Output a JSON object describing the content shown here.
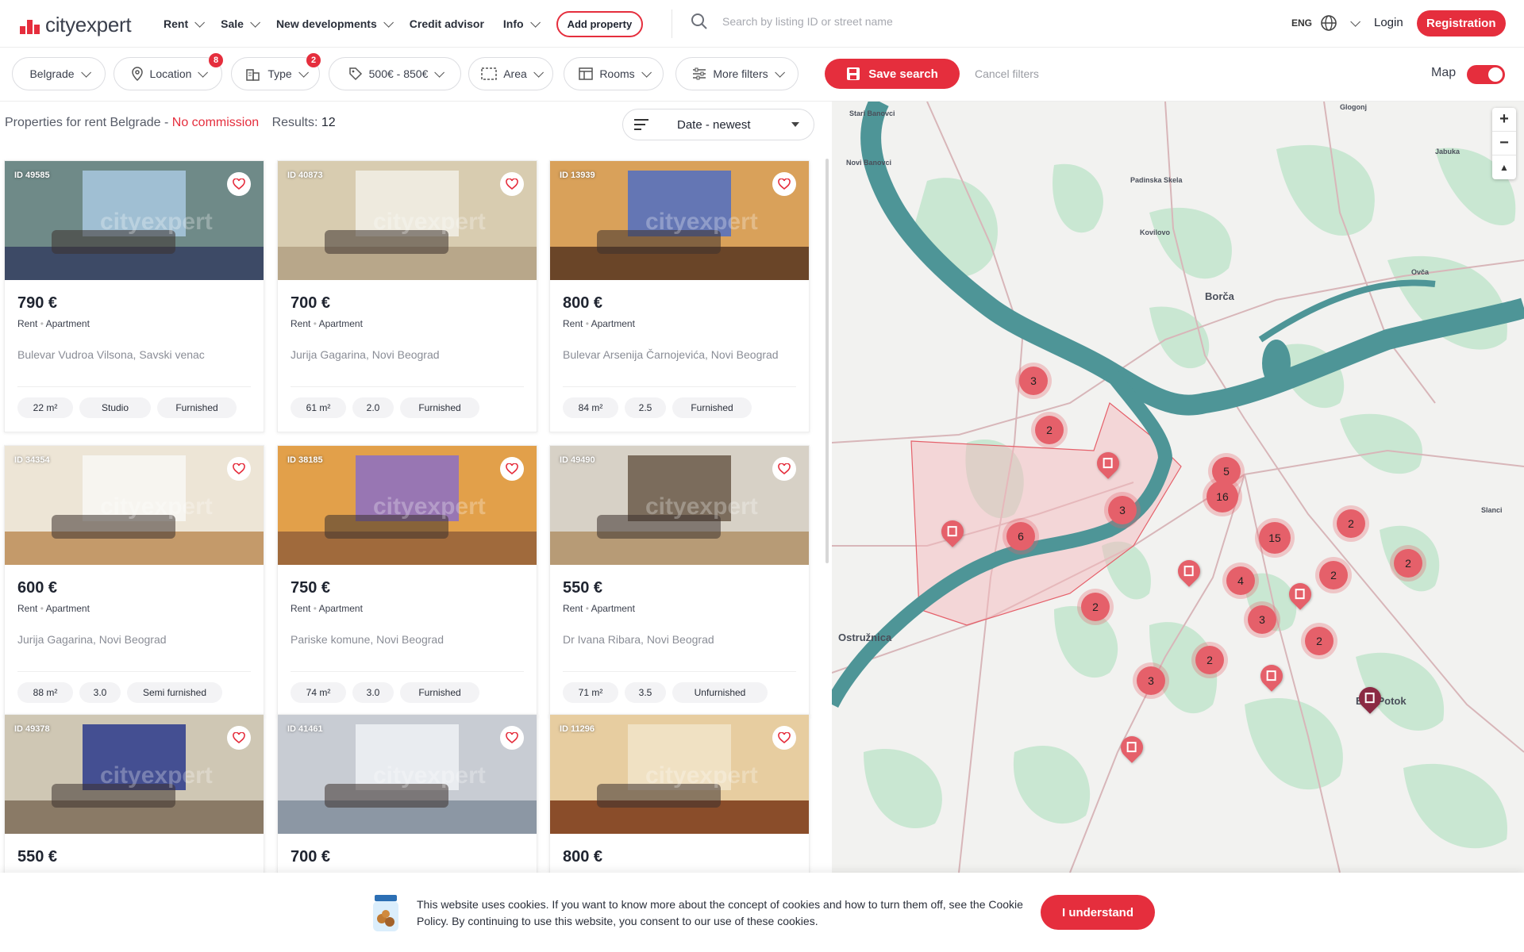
{
  "brand": {
    "name": "cityexpert",
    "accent": "#e52e3d"
  },
  "nav": [
    {
      "label": "Rent",
      "dropdown": true
    },
    {
      "label": "Sale",
      "dropdown": true
    },
    {
      "label": "New developments",
      "dropdown": true
    },
    {
      "label": "Credit advisor",
      "dropdown": false
    },
    {
      "label": "Info",
      "dropdown": true
    }
  ],
  "header": {
    "add_property": "Add property",
    "search_placeholder": "Search by listing ID or street name",
    "language": "ENG",
    "login": "Login",
    "register": "Registration"
  },
  "filters": {
    "city": "Belgrade",
    "location": "Location",
    "location_badge": "8",
    "type": "Type",
    "type_badge": "2",
    "price": "500€ - 850€",
    "area": "Area",
    "rooms": "Rooms",
    "more": "More filters",
    "save_search": "Save search",
    "cancel": "Cancel filters",
    "map_label": "Map",
    "map_on": true
  },
  "results": {
    "title": "Properties for rent Belgrade -",
    "no_commission": "No commission",
    "results_label": "Results:",
    "count": "12",
    "sort": "Date - newest"
  },
  "listings": [
    {
      "id": "ID 49585",
      "price": "790 €",
      "offer": "Rent",
      "type": "Apartment",
      "address": "Bulevar Vudroa Vilsona, Savski venac",
      "area": "22 m²",
      "rooms": "Studio",
      "furnishing": "Furnished",
      "wall": "#6f8a88",
      "floor": "#3d4a66",
      "window": "#a9c8e0"
    },
    {
      "id": "ID 40873",
      "price": "700 €",
      "offer": "Rent",
      "type": "Apartment",
      "address": "Jurija Gagarina, Novi Beograd",
      "area": "61 m²",
      "rooms": "2.0",
      "furnishing": "Furnished",
      "wall": "#d8ccb0",
      "floor": "#b8a78a",
      "window": "#f2efe6"
    },
    {
      "id": "ID 13939",
      "price": "800 €",
      "offer": "Rent",
      "type": "Apartment",
      "address": "Bulevar Arsenija Čarnojevića, Novi Beograd",
      "area": "84 m²",
      "rooms": "2.5",
      "furnishing": "Furnished",
      "wall": "#d9a15a",
      "floor": "#6a4528",
      "window": "#4f6fc4"
    },
    {
      "id": "ID 34354",
      "price": "600 €",
      "offer": "Rent",
      "type": "Apartment",
      "address": "Jurija Gagarina, Novi Beograd",
      "area": "88 m²",
      "rooms": "3.0",
      "furnishing": "Semi furnished",
      "wall": "#ede5d6",
      "floor": "#c49a6a",
      "window": "#f8f8f5"
    },
    {
      "id": "ID 38185",
      "price": "750 €",
      "offer": "Rent",
      "type": "Apartment",
      "address": "Pariske komune, Novi Beograd",
      "area": "74 m²",
      "rooms": "3.0",
      "furnishing": "Furnished",
      "wall": "#e2a04a",
      "floor": "#a06a3c",
      "window": "#8b6fc6"
    },
    {
      "id": "ID 49490",
      "price": "550 €",
      "offer": "Rent",
      "type": "Apartment",
      "address": "Dr Ivana Ribara, Novi Beograd",
      "area": "71 m²",
      "rooms": "3.5",
      "furnishing": "Unfurnished",
      "wall": "#d7d1c6",
      "floor": "#b79b76",
      "window": "#6b5a49"
    },
    {
      "id": "ID 49378",
      "price": "550 €",
      "offer": "Rent",
      "type": "Apartment",
      "address": "",
      "area": "",
      "rooms": "",
      "furnishing": "",
      "wall": "#cfc7b4",
      "floor": "#8a7a66",
      "window": "#2c3a8c"
    },
    {
      "id": "ID 41461",
      "price": "700 €",
      "offer": "Rent",
      "type": "Apartment",
      "address": "",
      "area": "",
      "rooms": "",
      "furnishing": "",
      "wall": "#c8ccd3",
      "floor": "#8c97a4",
      "window": "#eef1f5"
    },
    {
      "id": "ID 11296",
      "price": "800 €",
      "offer": "Rent",
      "type": "Apartment",
      "address": "",
      "area": "",
      "rooms": "",
      "furnishing": "",
      "wall": "#e7cda0",
      "floor": "#8a4d2a",
      "window": "#f1e4c9"
    }
  ],
  "map": {
    "places": [
      "Glogonj",
      "Stari Banovci",
      "Novi Banovci",
      "Padinska Skela",
      "Jabuka",
      "Kovilovo",
      "Borča",
      "Ovča",
      "Slanci",
      "Ostružnica",
      "Beli Potok"
    ],
    "clusters": [
      "3",
      "2",
      "5",
      "16",
      "3",
      "6",
      "15",
      "2",
      "2",
      "2",
      "4",
      "2",
      "3",
      "2",
      "2",
      "3"
    ],
    "colors": {
      "water": "#4e9597",
      "park": "#c9e7d2",
      "road": "#d8b6b9",
      "cluster": "#e5606a",
      "zone": "#f4b9bd"
    }
  },
  "cookie": {
    "text": "This website uses cookies. If you want to know more about the concept of cookies and how to turn them off, see the Cookie Policy. By continuing to use this website, you consent to our use of these cookies.",
    "button": "I understand"
  }
}
